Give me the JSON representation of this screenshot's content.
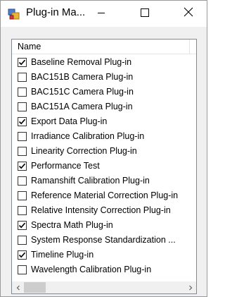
{
  "window": {
    "title": "Plug-in Ma...",
    "icon": "plugin-app-icon",
    "controls": [
      "minimize-icon",
      "maximize-icon",
      "close-icon"
    ]
  },
  "list": {
    "column_header": "Name",
    "items": [
      {
        "label": "Baseline Removal Plug-in",
        "checked": true
      },
      {
        "label": "BAC151B Camera Plug-in",
        "checked": false
      },
      {
        "label": "BAC151C Camera Plug-in",
        "checked": false
      },
      {
        "label": "BAC151A Camera Plug-in",
        "checked": false
      },
      {
        "label": "Export Data Plug-in",
        "checked": true
      },
      {
        "label": "Irradiance Calibration Plug-in",
        "checked": false
      },
      {
        "label": "Linearity Correction Plug-in",
        "checked": false
      },
      {
        "label": "Performance Test",
        "checked": true
      },
      {
        "label": "Ramanshift Calibration Plug-in",
        "checked": false
      },
      {
        "label": "Reference Material Correction Plug-in",
        "checked": false
      },
      {
        "label": "Relative Intensity Correction Plug-in",
        "checked": false
      },
      {
        "label": "Spectra Math Plug-in",
        "checked": true
      },
      {
        "label": "System Response Standardization ...",
        "checked": false
      },
      {
        "label": "Timeline Plug-in",
        "checked": true
      },
      {
        "label": "Wavelength Calibration Plug-in",
        "checked": false
      }
    ]
  },
  "scrollbar": {
    "left_icon": "chevron-left-icon",
    "right_icon": "chevron-right-icon"
  }
}
